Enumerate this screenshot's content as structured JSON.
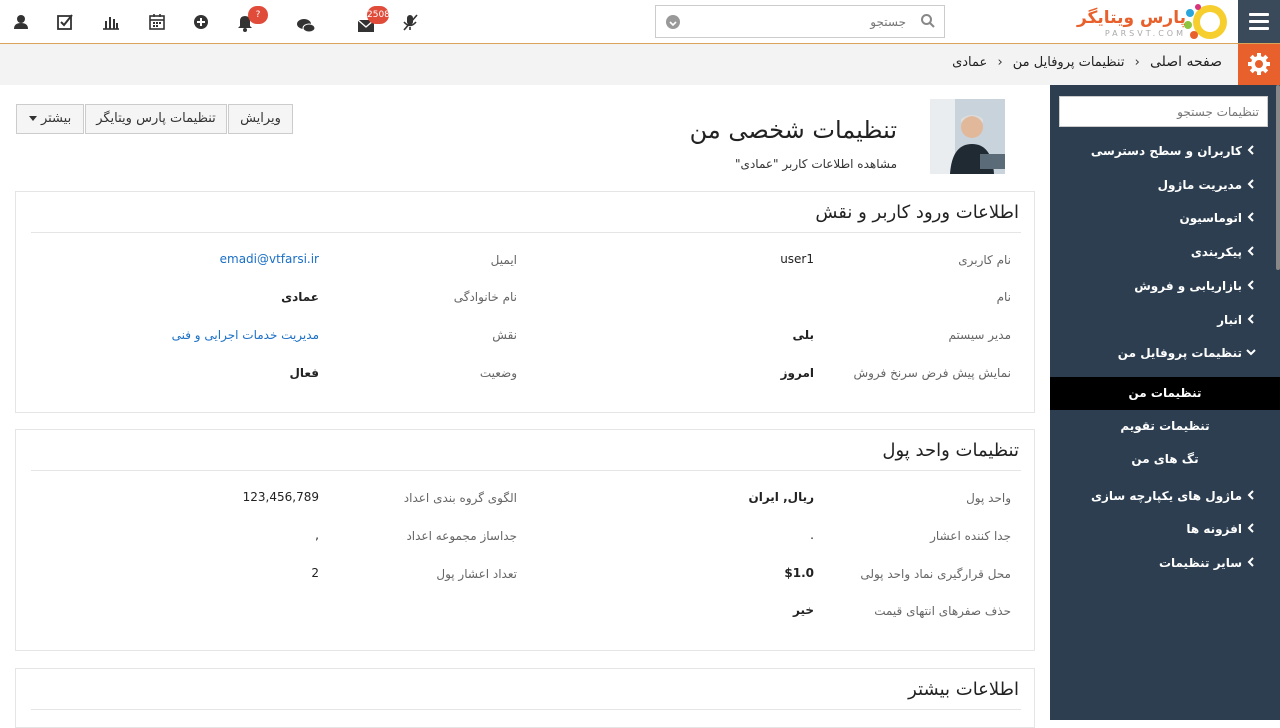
{
  "topbar": {
    "logo": "پارس ویتایگر",
    "logo_sub": "PARSVT.COM",
    "search_placeholder": "جستجو",
    "mail_badge": "2508",
    "notif_badge": "?"
  },
  "breadcrumb": {
    "home": "صفحه اصلی",
    "profile": "تنظیمات پروفایل من",
    "current": "عمادی"
  },
  "sidebar": {
    "search_placeholder": "تنظیمات جستجو",
    "items": [
      {
        "label": "کاربران و سطح دسترسی"
      },
      {
        "label": "مدیریت ماژول"
      },
      {
        "label": "اتوماسیون"
      },
      {
        "label": "پیکربندی"
      },
      {
        "label": "بازاریابی و فروش"
      },
      {
        "label": "انبار"
      },
      {
        "label": "تنظیمات پروفایل من"
      }
    ],
    "subitems": [
      {
        "label": "تنظیمات من"
      },
      {
        "label": "تنظیمات تقویم"
      },
      {
        "label": "تگ های من"
      }
    ],
    "items2": [
      {
        "label": "ماژول های یکپارچه سازی"
      },
      {
        "label": "افزونه ها"
      },
      {
        "label": "سایر تنظیمات"
      }
    ]
  },
  "header": {
    "title": "تنظیمات شخصی من",
    "subtitle": "مشاهده اطلاعات کاربر \"عمادی\"",
    "buttons": {
      "edit": "ویرایش",
      "parsvt_settings": "تنظیمات پارس ویتایگر",
      "more": "بیشتر"
    }
  },
  "panel1": {
    "title": "اطلاعات ورود کاربر و نقش",
    "fields": [
      {
        "label": "نام کاربری",
        "value": "user1"
      },
      {
        "label": "ایمیل",
        "value": "emadi@vtfarsi.ir"
      },
      {
        "label": "نام",
        "value": ""
      },
      {
        "label": "نام خانوادگی",
        "value": "عمادی"
      },
      {
        "label": "مدیر سیستم",
        "value": "بلی"
      },
      {
        "label": "نقش",
        "value": "مدیریت خدمات اجرایی و فنی"
      },
      {
        "label": "نمایش پیش فرض سرنخ فروش",
        "value": "امروز"
      },
      {
        "label": "وضعیت",
        "value": "فعال"
      }
    ]
  },
  "panel2": {
    "title": "تنظیمات واحد پول",
    "fields": [
      {
        "label": "واحد پول",
        "value": "ریال, ایران"
      },
      {
        "label": "الگوی گروه بندی اعداد",
        "value": "123,456,789"
      },
      {
        "label": "جدا کننده اعشار",
        "value": "."
      },
      {
        "label": "جداساز مجموعه اعداد",
        "value": ","
      },
      {
        "label": "محل قرارگیری نماد واحد پولی",
        "value": "$1.0"
      },
      {
        "label": "تعداد اعشار پول",
        "value": "2"
      },
      {
        "label": "حذف صفرهای انتهای قیمت",
        "value": "خیر"
      }
    ]
  },
  "panel3": {
    "title": "اطلاعات بیشتر"
  }
}
